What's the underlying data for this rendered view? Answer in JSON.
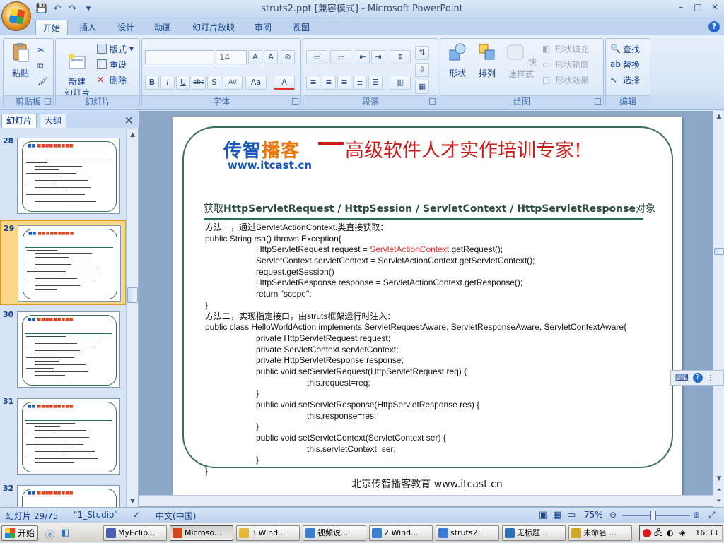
{
  "window": {
    "title": "struts2.ppt [兼容模式] - Microsoft PowerPoint",
    "controls": [
      "–",
      "□",
      "✕"
    ]
  },
  "qat": {
    "icons": [
      "save-icon",
      "undo-icon",
      "redo-icon",
      "customize-icon"
    ]
  },
  "tabs": [
    "开始",
    "插入",
    "设计",
    "动画",
    "幻灯片放映",
    "审阅",
    "视图"
  ],
  "ribbon": {
    "clipboard": {
      "label": "剪贴板",
      "paste": "粘贴"
    },
    "slides": {
      "label": "幻灯片",
      "new_slide": "新建\n幻灯片",
      "layout": "版式",
      "reset": "重设",
      "delete": "删除"
    },
    "font": {
      "label": "字体",
      "font_name": "",
      "font_size": "14",
      "buttons": [
        "B",
        "I",
        "U",
        "abc",
        "S",
        "AV",
        "Aa",
        "A"
      ]
    },
    "paragraph": {
      "label": "段落"
    },
    "drawing": {
      "label": "绘图",
      "shapes": "形状",
      "arrange": "排列",
      "quick_styles": "快速样式",
      "shape_fill": "形状填充",
      "shape_outline": "形状轮廓",
      "shape_effects": "形状效果"
    },
    "editing": {
      "label": "编辑",
      "find": "查找",
      "replace": "替换",
      "select": "选择"
    }
  },
  "pane": {
    "tab_slides": "幻灯片",
    "tab_outline": "大纲",
    "thumbnails": [
      {
        "num": "28",
        "selected": false
      },
      {
        "num": "29",
        "selected": true
      },
      {
        "num": "30",
        "selected": false
      },
      {
        "num": "31",
        "selected": false
      },
      {
        "num": "32",
        "selected": false
      }
    ]
  },
  "slide": {
    "brand_prefix": "传智",
    "brand_hot": "播客",
    "brand_url": "www.itcast.cn",
    "slogan": "高级软件人才实作培训专家!",
    "subtitle_pre": "获取",
    "subtitle_bold": "HttpServletRequest / HttpSession / ServletContext / HttpServletResponse",
    "subtitle_post": "对象",
    "code_lines": [
      {
        "indent": 0,
        "text": "方法一，通过ServletActionContext.类直接获取："
      },
      {
        "indent": 0,
        "text": "public String rsa() throws Exception{"
      },
      {
        "indent": 1,
        "pre": "HttpServletRequest request = ",
        "red": "ServletActionContext",
        "post": ".getRequest();"
      },
      {
        "indent": 1,
        "text": "ServletContext servletContext = ServletActionContext.getServletContext();"
      },
      {
        "indent": 1,
        "text": "request.getSession()"
      },
      {
        "indent": 1,
        "text": "HttpServletResponse response = ServletActionContext.getResponse();"
      },
      {
        "indent": 1,
        "text": "return \"scope\";"
      },
      {
        "indent": 0,
        "text": "}"
      },
      {
        "indent": 0,
        "text": "方法二，实现指定接口，由struts框架运行时注入："
      },
      {
        "indent": 0,
        "text": "public class HelloWorldAction implements ServletRequestAware, ServletResponseAware, ServletContextAware{"
      },
      {
        "indent": 1,
        "text": "private HttpServletRequest request;"
      },
      {
        "indent": 1,
        "text": "private ServletContext servletContext;"
      },
      {
        "indent": 1,
        "text": "private HttpServletResponse response;"
      },
      {
        "indent": 1,
        "text": "public void setServletRequest(HttpServletRequest req) {"
      },
      {
        "indent": 2,
        "text": "this.request=req;"
      },
      {
        "indent": 1,
        "text": "}"
      },
      {
        "indent": 1,
        "text": "public void setServletResponse(HttpServletResponse res) {"
      },
      {
        "indent": 2,
        "text": "this.response=res;"
      },
      {
        "indent": 1,
        "text": "}"
      },
      {
        "indent": 1,
        "text": "public void setServletContext(ServletContext ser) {"
      },
      {
        "indent": 2,
        "text": "this.servletContext=ser;"
      },
      {
        "indent": 1,
        "text": "}"
      },
      {
        "indent": 0,
        "text": "}"
      }
    ],
    "footer": "北京传智播客教育 www.itcast.cn"
  },
  "status": {
    "slide_pos": "幻灯片 29/75",
    "theme": "\"1_Studio\"",
    "language": "中文(中国)",
    "zoom": "75%",
    "zoom_fraction": 0.45
  },
  "taskbar": {
    "start": "开始",
    "tasks": [
      {
        "label": "MyEclip...",
        "color": "#4a5fb0",
        "active": false
      },
      {
        "label": "Microso...",
        "color": "#d2471d",
        "active": true
      },
      {
        "label": "3 Wind...",
        "color": "#e4b63a",
        "active": false
      },
      {
        "label": "视频说...",
        "color": "#3c7dd0",
        "active": false
      },
      {
        "label": "2 Wind...",
        "color": "#3c7dd0",
        "active": false
      },
      {
        "label": "struts2...",
        "color": "#3c7dd0",
        "active": false
      },
      {
        "label": "无标题 ...",
        "color": "#2a6fb8",
        "active": false
      },
      {
        "label": "未命名 ...",
        "color": "#d2a62a",
        "active": false
      }
    ],
    "clock": "16:33"
  },
  "colors": {
    "accent": "#15428b",
    "slogan": "#c81c1c",
    "brand": "#1a56b6",
    "frame": "#3d6b63"
  }
}
